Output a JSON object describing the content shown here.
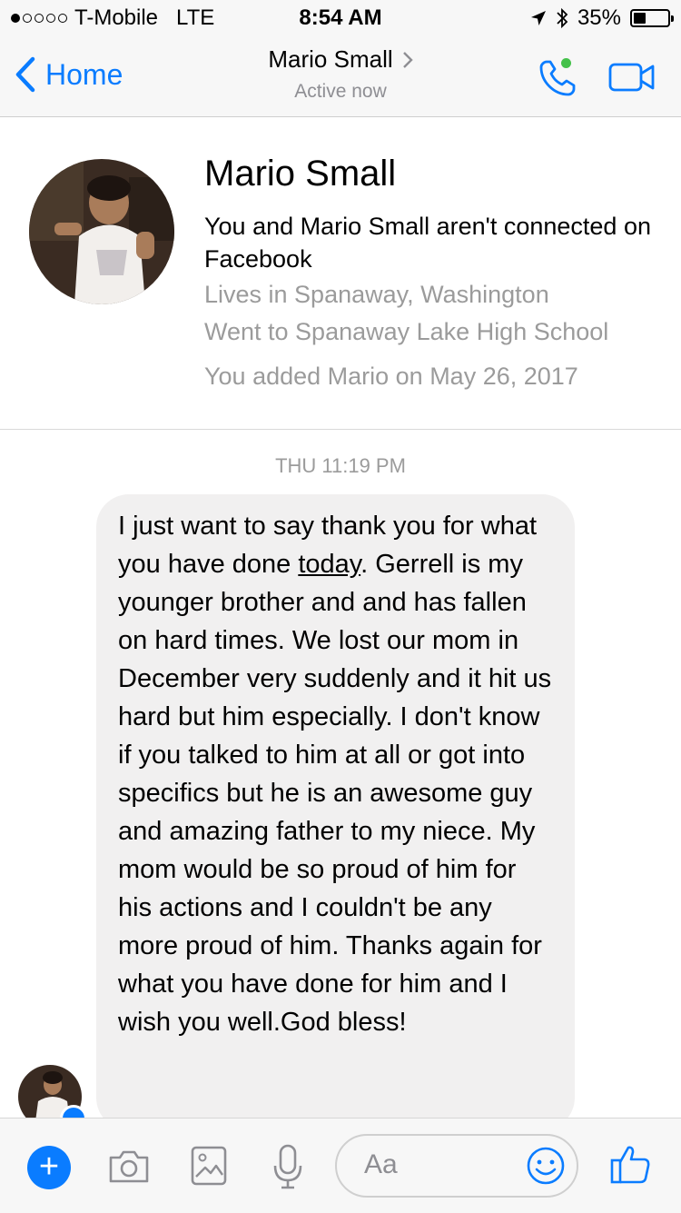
{
  "status_bar": {
    "carrier": "T-Mobile",
    "network": "LTE",
    "time": "8:54 AM",
    "battery_percent": "35%",
    "battery_level": 0.35,
    "signal_bars_filled": 1,
    "signal_bars_total": 5
  },
  "nav": {
    "back_label": "Home",
    "contact_name": "Mario Small",
    "presence": "Active now",
    "accent_color": "#0a7cff",
    "online_dot_color": "#44c14a"
  },
  "profile": {
    "name": "Mario Small",
    "connection": "You and Mario Small aren't connected on Facebook",
    "lives_in": "Lives in Spanaway, Washington",
    "education": "Went to Spanaway Lake High School",
    "added": "You added Mario on May 26, 2017"
  },
  "conversation": {
    "timestamp": "THU 11:19 PM",
    "message": {
      "before_link": "I just want to say thank you for what you have done ",
      "link": "today",
      "after_link": ". Gerrell is my younger brother and and has fallen on hard times. We lost our mom in December very suddenly and it hit us hard but him especially. I don't know if you talked to him at all or got into specifics but he is an awesome guy and amazing father to my niece. My mom would be so proud of him for his actions and I couldn't be any more proud of him. Thanks again for what you have done for him and I wish you well.God bless!"
    }
  },
  "composer": {
    "placeholder": "Aa",
    "icons": [
      "plus-icon",
      "camera-icon",
      "gallery-icon",
      "microphone-icon",
      "emoji-icon",
      "thumbs-up-icon"
    ]
  }
}
